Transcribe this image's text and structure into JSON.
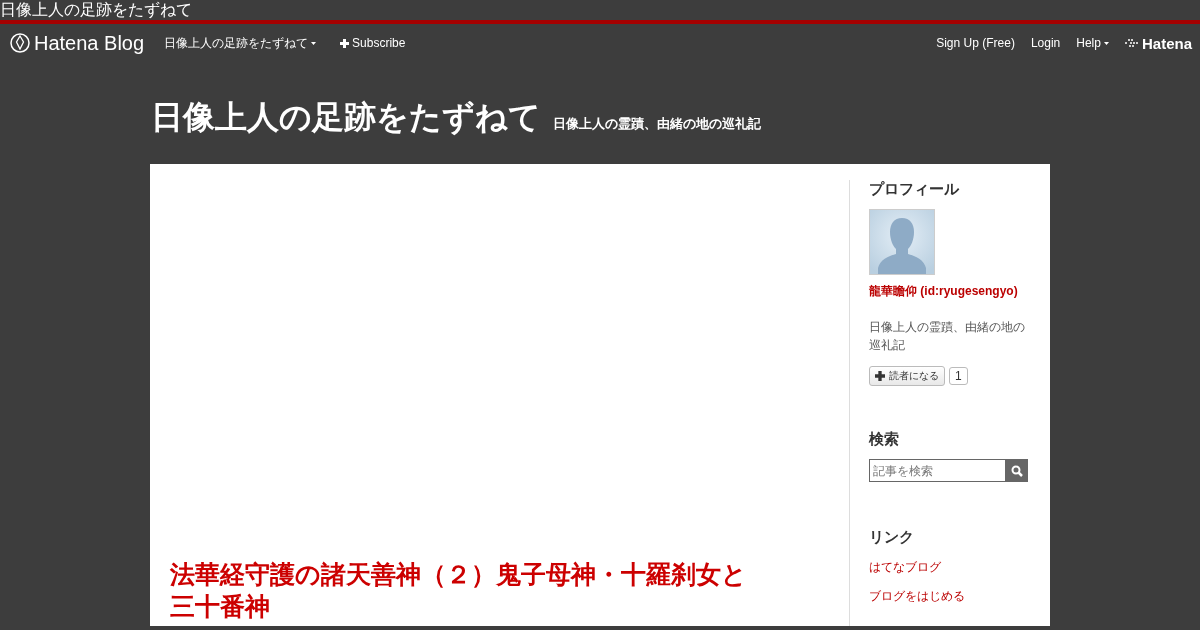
{
  "window": {
    "title": "日像上人の足跡をたずねて"
  },
  "navbar": {
    "brand": "Hatena Blog",
    "blog_menu": "日像上人の足跡をたずねて",
    "subscribe": "Subscribe",
    "right_links": [
      "Sign Up (Free)",
      "Login"
    ],
    "help": "Help",
    "hatena": "Hatena"
  },
  "header": {
    "title": "日像上人の足跡をたずねて",
    "description": "日像上人の霊蹟、由緒の地の巡礼記"
  },
  "article": {
    "title": "法華経守護の諸天善神（２）鬼子母神・十羅刹女と三十番神"
  },
  "sidebar": {
    "profile": {
      "heading": "プロフィール",
      "name": "龍華瞻仰 (id:ryugesengyo)",
      "description": "日像上人の霊蹟、由緒の地の巡礼記",
      "subscribe": "読者になる",
      "count": "1"
    },
    "search": {
      "heading": "検索",
      "placeholder": "記事を検索"
    },
    "links": {
      "heading": "リンク",
      "items": [
        "はてなブログ",
        "ブログをはじめる"
      ]
    }
  }
}
